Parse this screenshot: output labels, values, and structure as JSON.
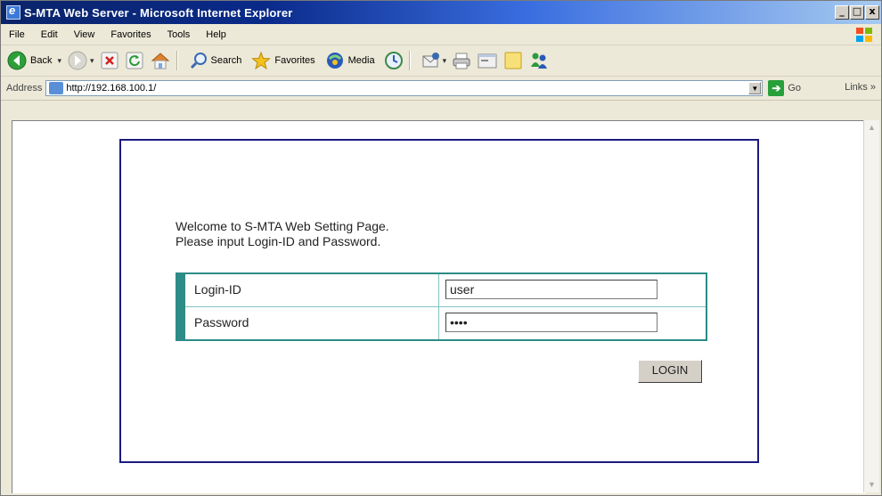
{
  "window": {
    "title": "S-MTA Web Server - Microsoft Internet Explorer",
    "min": "_",
    "max": "□",
    "close": "x"
  },
  "menu": [
    "File",
    "Edit",
    "View",
    "Favorites",
    "Tools",
    "Help"
  ],
  "toolbar": {
    "back": "Back",
    "search": "Search",
    "favorites": "Favorites",
    "media": "Media"
  },
  "address": {
    "label": "Address",
    "url": "http://192.168.100.1/",
    "go": "Go",
    "links": "Links"
  },
  "page": {
    "welcome_line1": "Welcome to S-MTA Web Setting Page.",
    "welcome_line2": "Please input Login-ID and Password.",
    "login_id_label": "Login-ID",
    "login_id_value": "user",
    "password_label": "Password",
    "password_value": "••••",
    "login_button": "LOGIN"
  },
  "colors": {
    "panel_border": "#1c1a80",
    "table_border": "#2b8c88",
    "title_bar": "#0a246a"
  }
}
